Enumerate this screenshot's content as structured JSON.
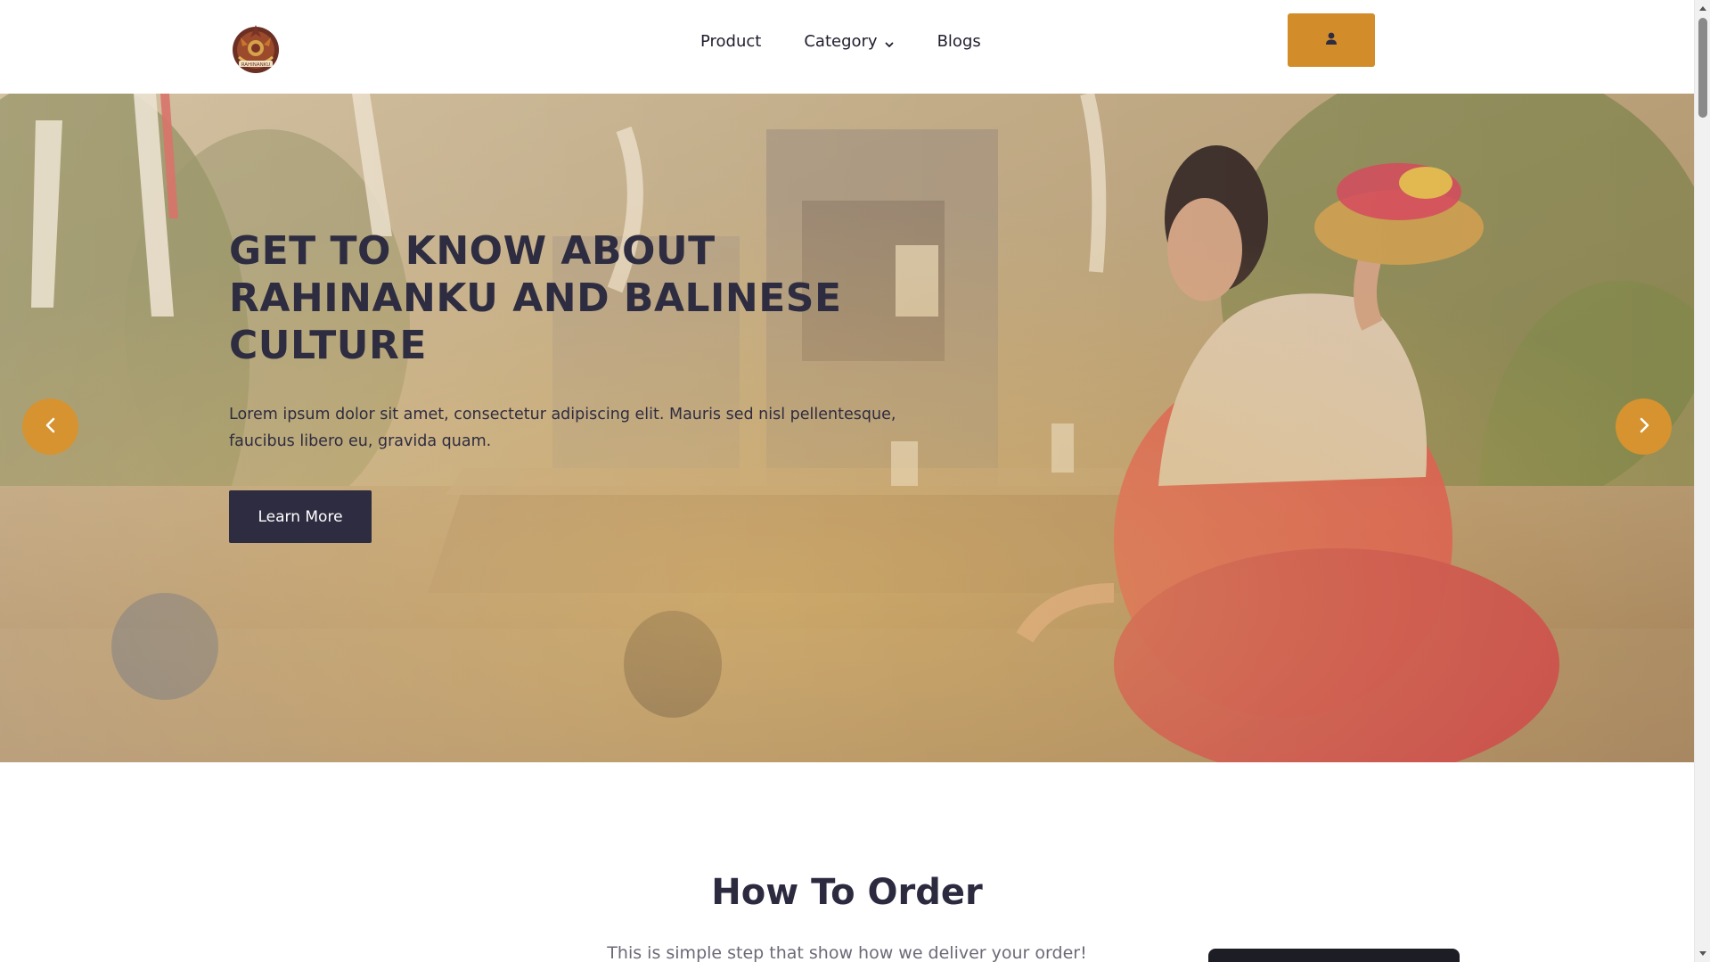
{
  "header": {
    "logo_text": "RAHINANKU",
    "nav": [
      {
        "label": "Product"
      },
      {
        "label": "Category"
      },
      {
        "label": "Blogs"
      }
    ],
    "user_icon": "user-icon",
    "accent_color": "#d28c2a"
  },
  "hero": {
    "title": "GET TO KNOW ABOUT RAHINANKU AND BALINESE CULTURE",
    "text": "Lorem ipsum dolor sit amet, consectetur adipiscing elit. Mauris sed nisl pellentesque, faucibus libero eu, gravida quam.",
    "cta_label": "Learn More",
    "prev_icon": "chevron-left-icon",
    "next_icon": "chevron-right-icon"
  },
  "how_to_order": {
    "title": "How To Order",
    "subtitle": "This is simple step that show how we deliver your order!"
  }
}
